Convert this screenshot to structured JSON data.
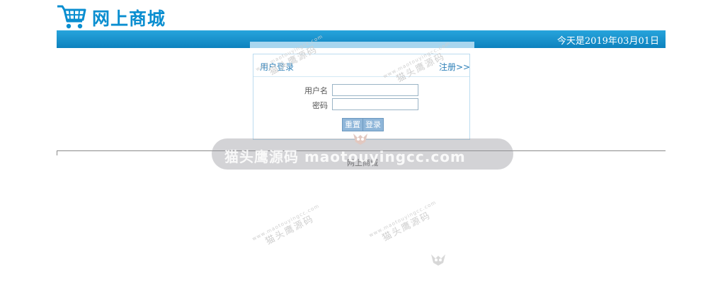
{
  "header": {
    "site_name": "网上商城",
    "date_text": "今天是2019年03月01日"
  },
  "login": {
    "title": "用户登录",
    "register_link": "注册>>",
    "username_label": "用户名",
    "password_label": "密码",
    "reset_button": "重置",
    "login_button": "登录"
  },
  "footer": {
    "text": "网上商城"
  },
  "watermark": {
    "banner_text": "猫头鹰源码 maotouyingcc.com",
    "stamp_main": "猫头鹰源码",
    "stamp_sub": "www.maotouyingcc.com"
  },
  "colors": {
    "brand_blue": "#0a8ed0",
    "topbar_blue": "#1593cd",
    "button_blue": "#8fb6d9"
  }
}
